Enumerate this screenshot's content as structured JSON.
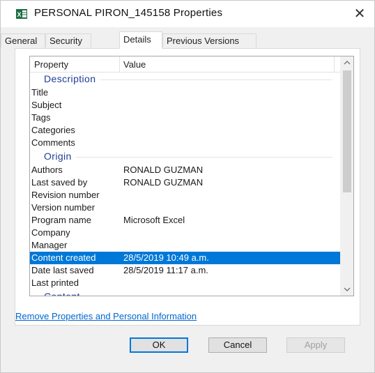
{
  "window": {
    "title": "PERSONAL PIRON_145158 Properties",
    "close_glyph": "✕"
  },
  "tabs": [
    {
      "label": "General",
      "active": false
    },
    {
      "label": "Security",
      "active": false
    },
    {
      "label": "Details",
      "active": true
    },
    {
      "label": "Previous Versions",
      "active": false
    }
  ],
  "list": {
    "header_property": "Property",
    "header_value": "Value",
    "groups": [
      {
        "label": "Description",
        "rows": [
          {
            "property": "Title",
            "value": ""
          },
          {
            "property": "Subject",
            "value": ""
          },
          {
            "property": "Tags",
            "value": ""
          },
          {
            "property": "Categories",
            "value": ""
          },
          {
            "property": "Comments",
            "value": ""
          }
        ]
      },
      {
        "label": "Origin",
        "rows": [
          {
            "property": "Authors",
            "value": "RONALD GUZMAN"
          },
          {
            "property": "Last saved by",
            "value": "RONALD GUZMAN"
          },
          {
            "property": "Revision number",
            "value": ""
          },
          {
            "property": "Version number",
            "value": ""
          },
          {
            "property": "Program name",
            "value": "Microsoft Excel"
          },
          {
            "property": "Company",
            "value": ""
          },
          {
            "property": "Manager",
            "value": ""
          },
          {
            "property": "Content created",
            "value": "28/5/2019 10:49 a.m.",
            "selected": true
          },
          {
            "property": "Date last saved",
            "value": "28/5/2019 11:17 a.m."
          },
          {
            "property": "Last printed",
            "value": ""
          }
        ]
      },
      {
        "label": "Content",
        "rows": []
      }
    ]
  },
  "remove_link": "Remove Properties and Personal Information",
  "buttons": {
    "ok": "OK",
    "cancel": "Cancel",
    "apply": "Apply"
  },
  "colors": {
    "selection": "#0078d7",
    "group_label": "#1e3c96",
    "link": "#0066cc"
  },
  "icons": {
    "app": "excel-file-icon",
    "scroll_up": "chevron-up-icon",
    "scroll_down": "chevron-down-icon",
    "close": "close-icon"
  }
}
